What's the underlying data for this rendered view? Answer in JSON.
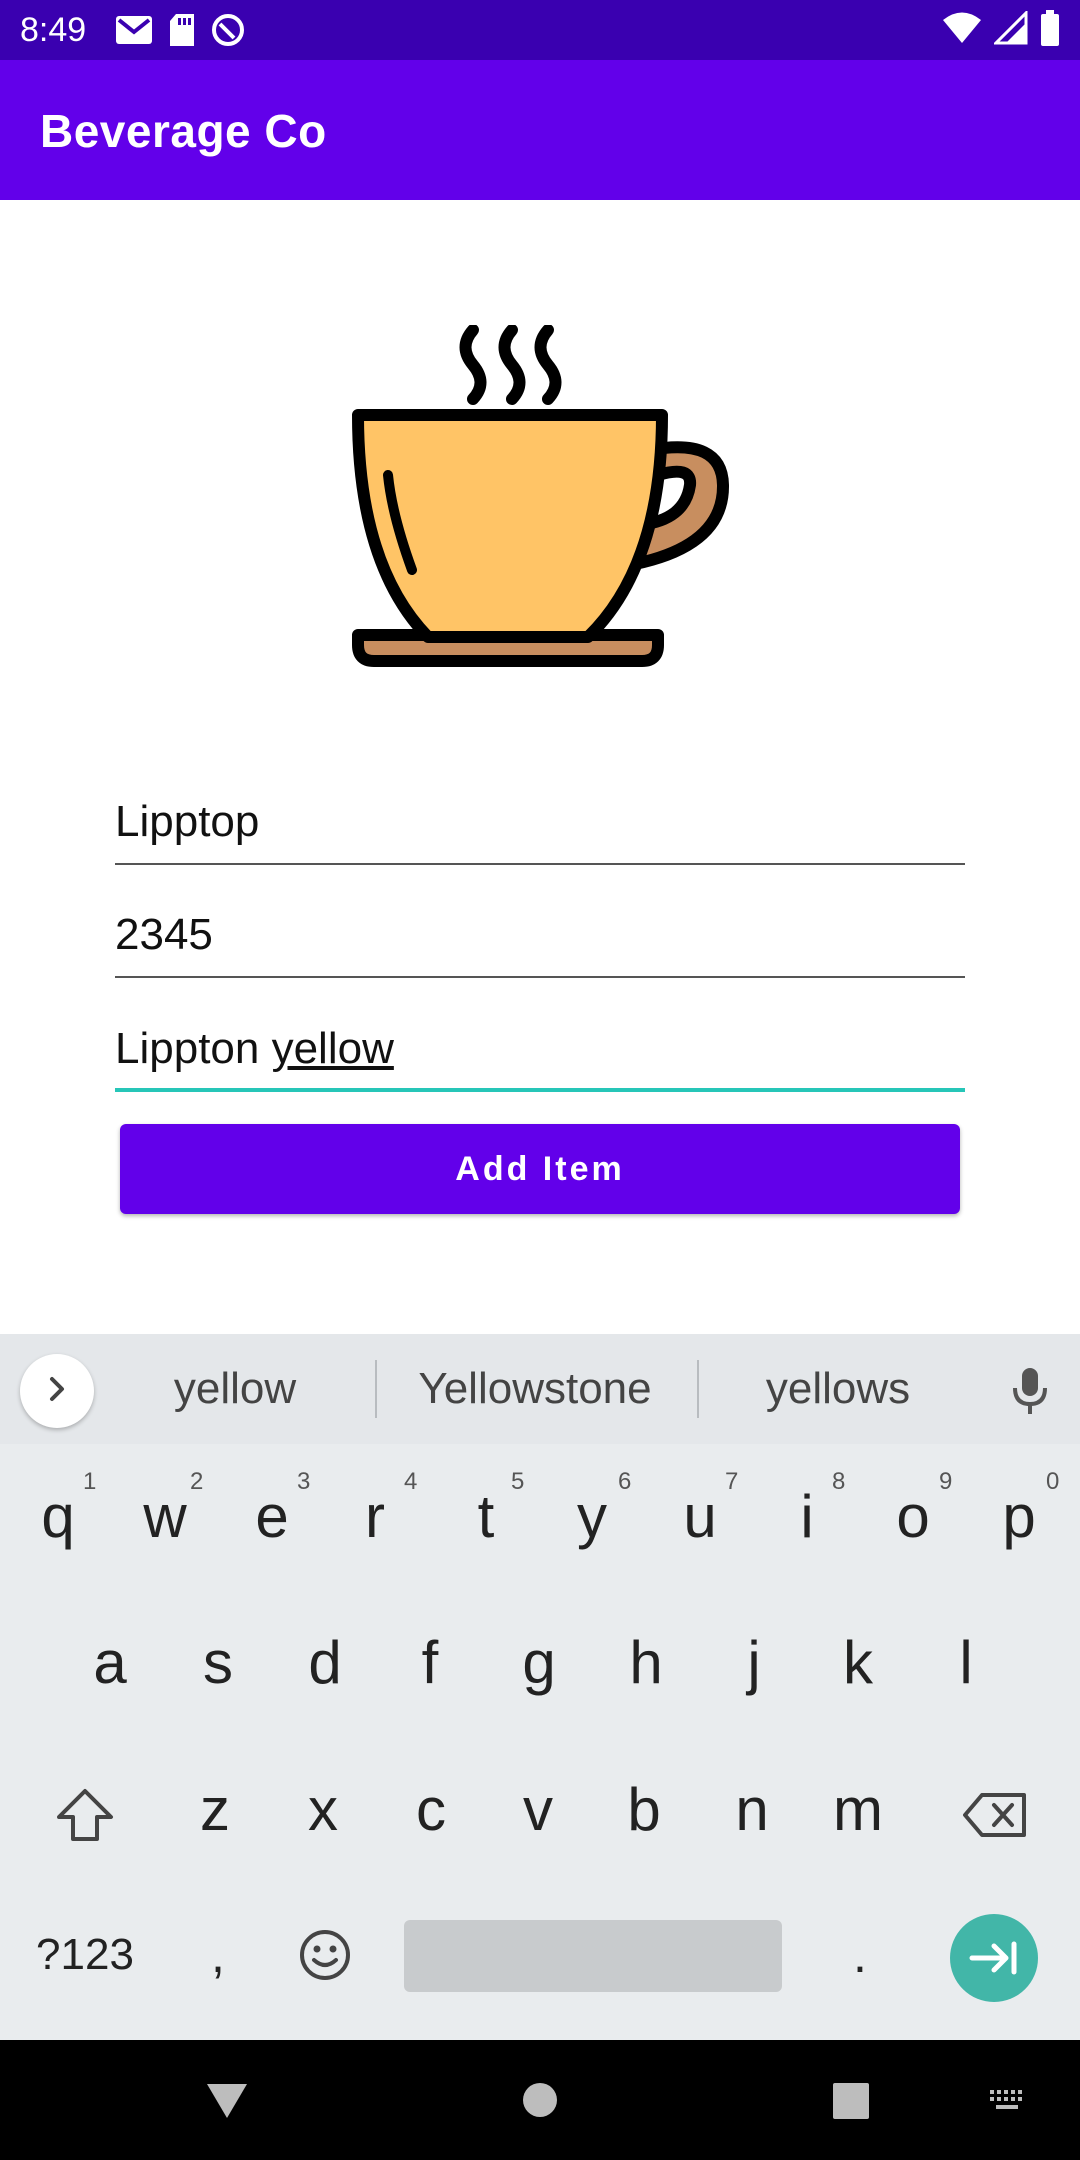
{
  "status_bar": {
    "time": "8:49",
    "left_icons": [
      "gmail-icon",
      "sd-card-icon",
      "data-saver-icon"
    ],
    "right_icons": [
      "wifi-icon",
      "signal-icon",
      "battery-icon"
    ]
  },
  "app_bar": {
    "title": "Beverage Co"
  },
  "illustration": {
    "icon": "coffee-cup-icon",
    "colors": {
      "cup": "#ffc466",
      "saucer": "#c88e5f",
      "outline": "#000000"
    }
  },
  "form": {
    "name_value": "Lipptop",
    "number_value": "2345",
    "description_prefix": "Lippton ",
    "description_composing": "yellow",
    "add_button_label": "Add Item"
  },
  "keyboard": {
    "suggestions": [
      "yellow",
      "Yellowstone",
      "yellows"
    ],
    "row1": [
      "q",
      "w",
      "e",
      "r",
      "t",
      "y",
      "u",
      "i",
      "o",
      "p"
    ],
    "row1_hints": [
      "1",
      "2",
      "3",
      "4",
      "5",
      "6",
      "7",
      "8",
      "9",
      "0"
    ],
    "row2": [
      "a",
      "s",
      "d",
      "f",
      "g",
      "h",
      "j",
      "k",
      "l"
    ],
    "row3": [
      "z",
      "x",
      "c",
      "v",
      "b",
      "n",
      "m"
    ],
    "symbols_label": "?123",
    "comma": ",",
    "period": "."
  },
  "colors": {
    "status_bar": "#3a00b0",
    "primary": "#6200ea",
    "focus_underline": "#26c6b8",
    "enter_key": "#42b6a8"
  }
}
